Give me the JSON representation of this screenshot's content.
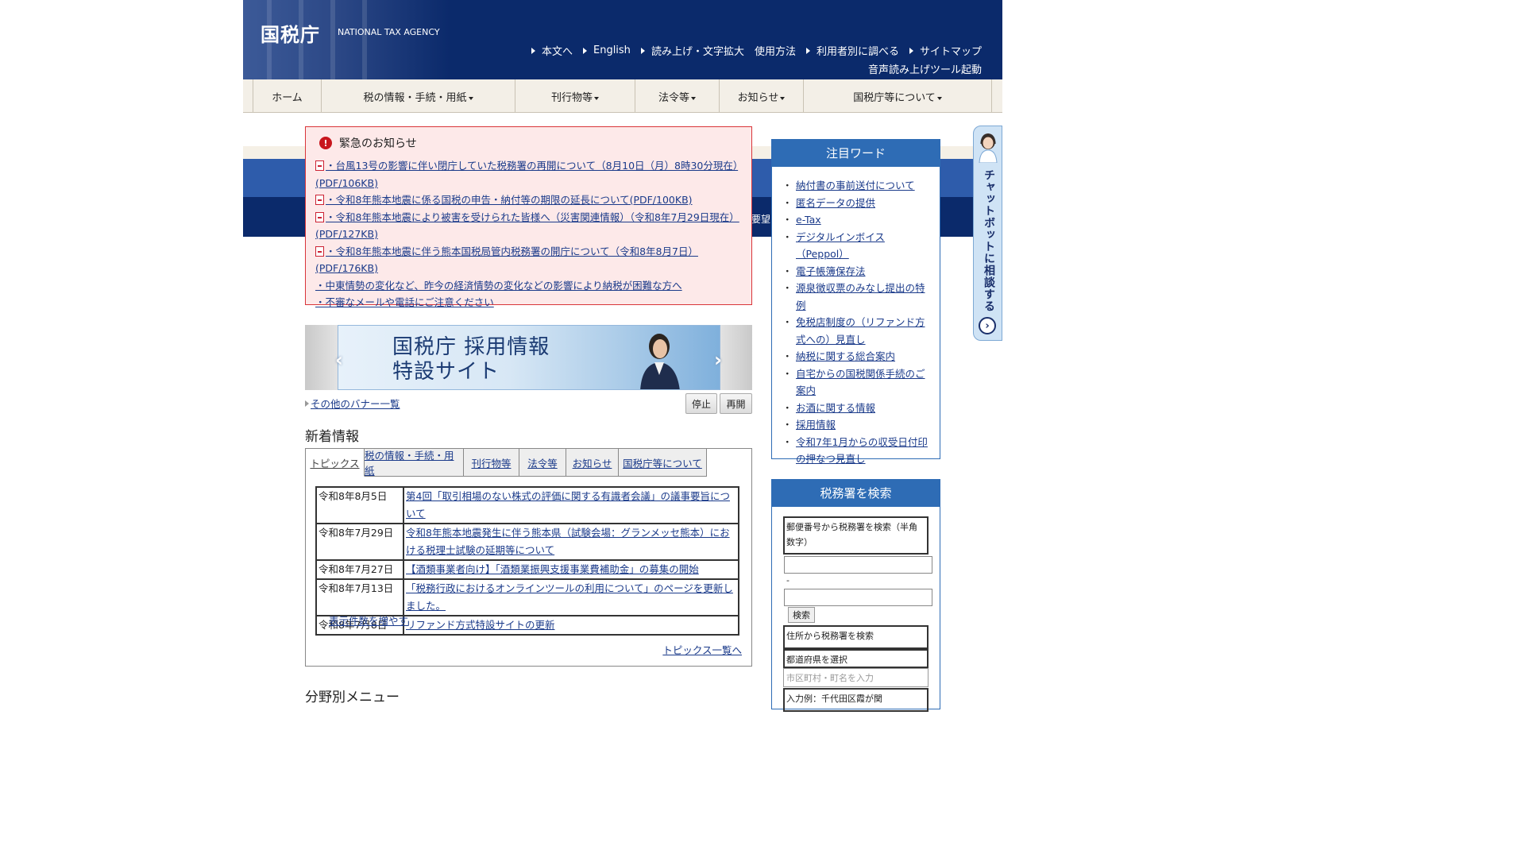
{
  "header": {
    "logo_ja": "国税庁",
    "logo_en": "NATIONAL TAX AGENCY",
    "util_links": [
      "本文へ",
      "English",
      "読み上げ・文字拡大",
      "使用方法",
      "利用者別に調べる",
      "サイトマップ"
    ],
    "voice_tool": "音声読み上げツール起動"
  },
  "nav": {
    "items": [
      "ホーム",
      "税の情報・手続・用紙",
      "刊行物等",
      "法令等",
      "お知らせ",
      "国税庁等について"
    ]
  },
  "band_text": "要望",
  "emergency": {
    "title": "緊急のお知らせ",
    "items": [
      "・台風13号の影響に伴い閉庁していた税務署の再開について（8月10日（月）8時30分現在）(PDF/106KB)",
      "・令和8年熊本地震に係る国税の申告・納付等の期限の延長について(PDF/100KB)",
      "・令和8年熊本地震により被害を受けられた皆様へ（災害関連情報）（令和8年7月29日現在）(PDF/127KB)",
      "・令和8年熊本地震に伴う熊本国税局管内税務署の開庁について（令和8年8月7日）(PDF/176KB)",
      "・中東情勢の変化など、昨今の経済情勢の変化などの影響により納税が困難な方へ",
      "・不審なメールや電話にご注意ください"
    ]
  },
  "banner": {
    "title_line1": "国税庁 採用情報",
    "title_line2": "特設サイト",
    "list_link": "その他のバナー一覧",
    "stop": "停止",
    "resume": "再開"
  },
  "news": {
    "title": "新着情報",
    "tabs": [
      "トピックス",
      "税の情報・手続・用紙",
      "刊行物等",
      "法令等",
      "お知らせ",
      "国税庁等について"
    ],
    "rows": [
      {
        "date": "令和8年8月5日",
        "text": "第4回「取引相場のない株式の評価に関する有識者会議」の議事要旨について"
      },
      {
        "date": "令和8年7月29日",
        "text": "令和8年熊本地震発生に伴う熊本県（試験会場：グランメッセ熊本）における税理士試験の延期等について"
      },
      {
        "date": "令和8年7月27日",
        "text": "【酒類事業者向け】「酒類業振興支援事業費補助金」の募集の開始"
      },
      {
        "date": "令和8年7月13日",
        "text": "「税務行政におけるオンラインツールの利用について」のページを更新しました。"
      },
      {
        "date": "令和8年7月8日",
        "text": "リファンド方式特設サイトの更新"
      }
    ],
    "more": "表示件数を増やす",
    "topics_list": "トピックス一覧へ"
  },
  "section_menu_title": "分野別メニュー",
  "keywords": {
    "title": "注目ワード",
    "items": [
      "納付書の事前送付について",
      "匿名データの提供",
      "e-Tax",
      "デジタルインボイス（Peppol）",
      "電子帳簿保存法",
      "源泉徴収票のみなし提出の特例",
      "免税店制度の（リファンド方式への）見直し",
      "納税に関する総合案内",
      "自宅からの国税関係手続のご案内",
      "お酒に関する情報",
      "採用情報",
      "令和7年1月からの収受日付印の押なつ見直し"
    ]
  },
  "tax_office": {
    "title": "税務署を検索",
    "postal_label": "郵便番号から税務署を検索（半角数字）",
    "hyphen": "-",
    "search_btn": "検索",
    "address_label": "住所から税務署を検索",
    "pref_label": "都道府県を選択",
    "city_placeholder": "市区町村・町名を入力",
    "example": "入力例：千代田区霞が関"
  },
  "chatbot": {
    "label": "チャットボットに相談する"
  },
  "colors": {
    "header_navy": "#0b2a6b",
    "accent_blue": "#2e6cb5",
    "alert_red": "#d9353a",
    "nav_beige": "#f3efe7"
  }
}
